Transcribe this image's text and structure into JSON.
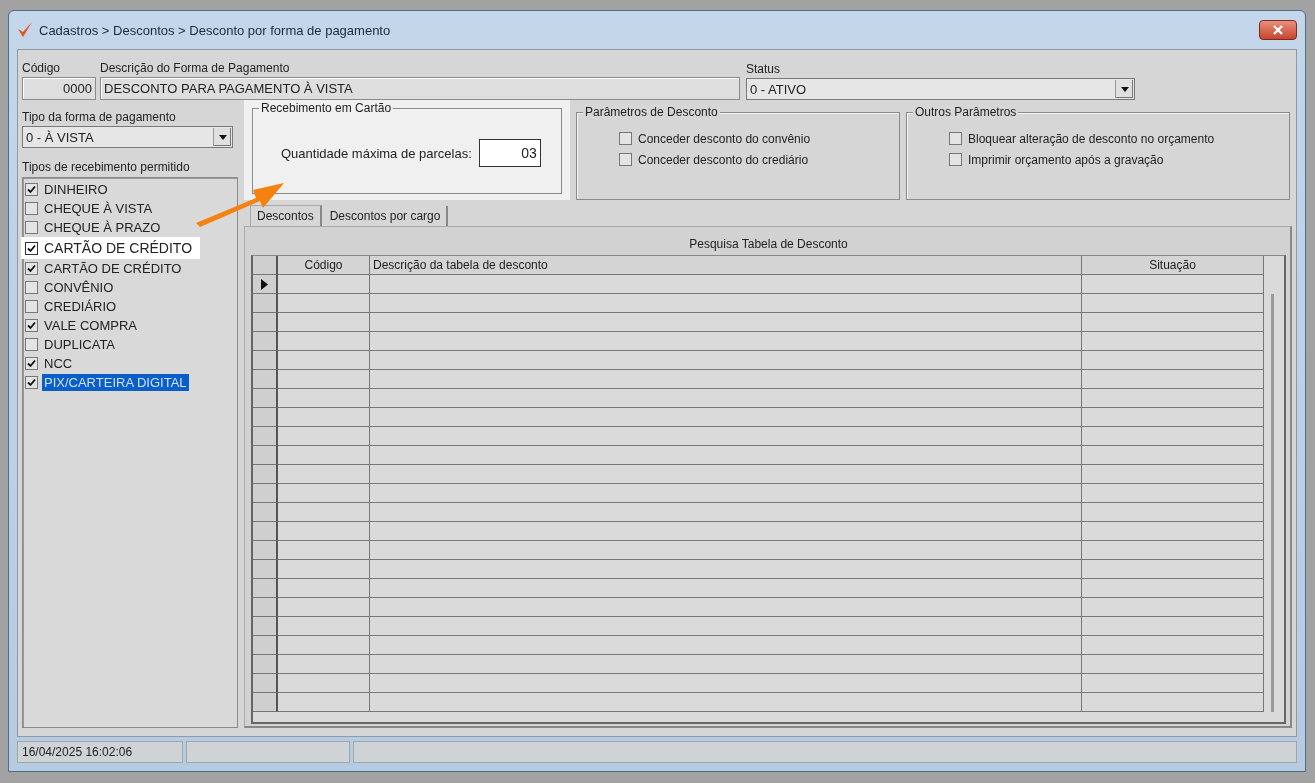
{
  "window": {
    "title": "Cadastros > Descontos > Desconto por forma de pagamento"
  },
  "header": {
    "code": {
      "label": "Código",
      "value": "0000"
    },
    "description": {
      "label": "Descrição do Forma de Pagamento",
      "value": "DESCONTO PARA PAGAMENTO À VISTA"
    },
    "status": {
      "label": "Status",
      "value": "0 - ATIVO"
    }
  },
  "payment_type": {
    "label": "Tipo da forma de pagamento",
    "value": "0 - À VISTA"
  },
  "receipt_types": {
    "label": "Tipos de recebimento permitido",
    "items": [
      {
        "label": "DINHEIRO",
        "checked": true,
        "selected": false,
        "highlighted": false
      },
      {
        "label": "CHEQUE À VISTA",
        "checked": false,
        "selected": false,
        "highlighted": false
      },
      {
        "label": "CHEQUE À PRAZO",
        "checked": false,
        "selected": false,
        "highlighted": false
      },
      {
        "label": "CARTÃO DE CRÉDITO",
        "checked": true,
        "selected": false,
        "highlighted": true
      },
      {
        "label": "CARTÃO DE CRÉDITO",
        "checked": true,
        "selected": false,
        "highlighted": false
      },
      {
        "label": "CONVÊNIO",
        "checked": false,
        "selected": false,
        "highlighted": false
      },
      {
        "label": "CREDIÁRIO",
        "checked": false,
        "selected": false,
        "highlighted": false
      },
      {
        "label": "VALE COMPRA",
        "checked": true,
        "selected": false,
        "highlighted": false
      },
      {
        "label": "DUPLICATA",
        "checked": false,
        "selected": false,
        "highlighted": false
      },
      {
        "label": "NCC",
        "checked": true,
        "selected": false,
        "highlighted": false
      },
      {
        "label": "PIX/CARTEIRA DIGITAL",
        "checked": true,
        "selected": true,
        "highlighted": false
      }
    ]
  },
  "card_receipt": {
    "title": "Recebimento em Cartão",
    "label": "Quantidade máxima de parcelas:",
    "value": "03",
    "highlighted": true
  },
  "discount_params": {
    "title": "Parâmetros de Desconto",
    "options": [
      {
        "label": "Conceder desconto do convênio",
        "checked": false
      },
      {
        "label": "Conceder desconto do crediário",
        "checked": false
      }
    ]
  },
  "other_params": {
    "title": "Outros Parâmetros",
    "options": [
      {
        "label": "Bloquear alteração de desconto no orçamento",
        "checked": false
      },
      {
        "label": "Imprimir orçamento após a gravação",
        "checked": false
      }
    ]
  },
  "tabs": [
    {
      "label": "Descontos",
      "selected": true
    },
    {
      "label": "Descontos por cargo",
      "selected": false
    }
  ],
  "grid": {
    "title": "Pesquisa Tabela de Desconto",
    "columns": [
      "Código",
      "Descrição da tabela de desconto",
      "Situação"
    ],
    "rows": [
      {
        "current": true
      },
      {
        "current": false
      },
      {
        "current": false
      },
      {
        "current": false
      },
      {
        "current": false
      },
      {
        "current": false
      },
      {
        "current": false
      },
      {
        "current": false
      },
      {
        "current": false
      },
      {
        "current": false
      },
      {
        "current": false
      },
      {
        "current": false
      },
      {
        "current": false
      },
      {
        "current": false
      },
      {
        "current": false
      },
      {
        "current": false
      },
      {
        "current": false
      },
      {
        "current": false
      },
      {
        "current": false
      },
      {
        "current": false
      },
      {
        "current": false
      },
      {
        "current": false
      },
      {
        "current": false
      }
    ]
  },
  "status_bar": {
    "datetime": "16/04/2025 16:02:06"
  }
}
